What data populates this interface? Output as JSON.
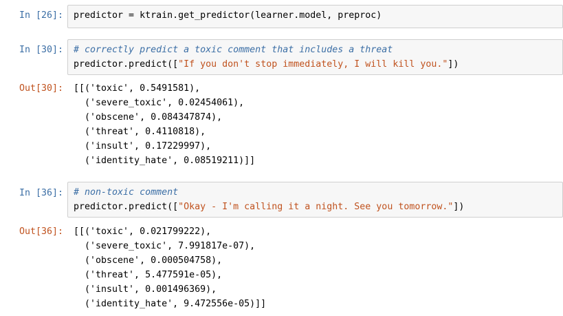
{
  "cells": [
    {
      "in_prompt": "In [26]:",
      "code": [
        {
          "text": "predictor = ktrain.get_predictor(learner.model, preproc)"
        }
      ]
    },
    {
      "in_prompt": "In [30]:",
      "comment": "# correctly predict a toxic comment that includes a threat",
      "code_pre": "predictor.predict([",
      "code_str": "\"If you don't stop immediately, I will kill you.\"",
      "code_post": "])",
      "out_prompt": "Out[30]:",
      "output": [
        "[[('toxic', 0.5491581),",
        "  ('severe_toxic', 0.02454061),",
        "  ('obscene', 0.084347874),",
        "  ('threat', 0.4110818),",
        "  ('insult', 0.17229997),",
        "  ('identity_hate', 0.08519211)]]"
      ]
    },
    {
      "in_prompt": "In [36]:",
      "comment": "# non-toxic comment",
      "code_pre": "predictor.predict([",
      "code_str": "\"Okay - I'm calling it a night. See you tomorrow.\"",
      "code_post": "])",
      "out_prompt": "Out[36]:",
      "output": [
        "[[('toxic', 0.021799222),",
        "  ('severe_toxic', 7.991817e-07),",
        "  ('obscene', 0.000504758),",
        "  ('threat', 5.477591e-05),",
        "  ('insult', 0.001496369),",
        "  ('identity_hate', 9.472556e-05)]]"
      ]
    }
  ],
  "colors": {
    "prompt_in": "#3b6ea5",
    "prompt_out": "#c0521e",
    "cell_bg": "#f7f7f7",
    "cell_border": "#cfcfcf"
  }
}
